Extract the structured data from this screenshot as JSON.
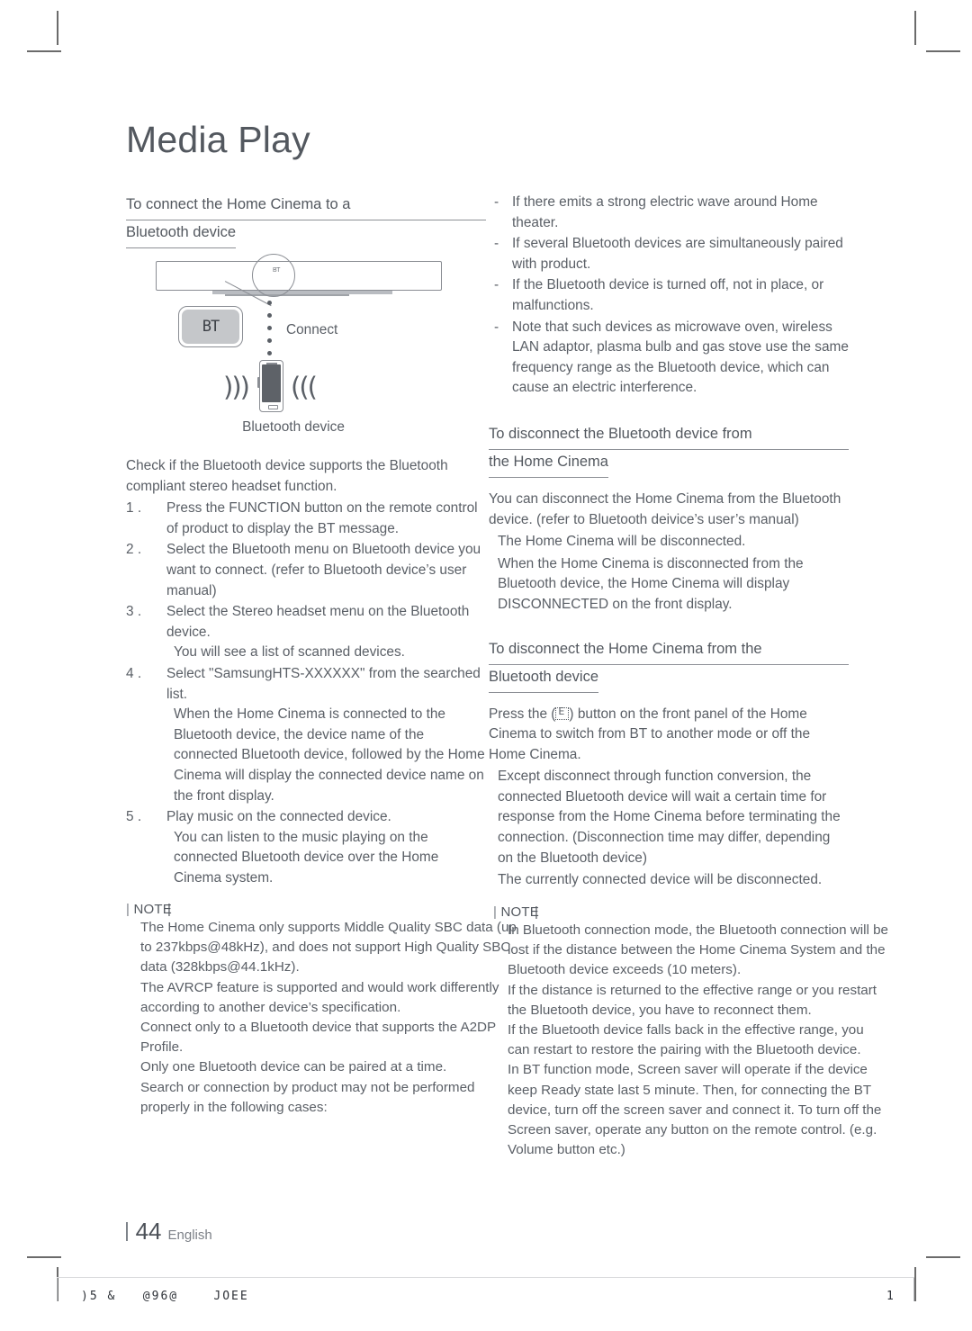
{
  "page": {
    "title": "Media Play",
    "footer_page_number": "44",
    "footer_language": "English",
    "footer_code": ")5 &   @96@    JOEE",
    "footer_sheet_number": "1"
  },
  "left_column": {
    "section1": {
      "heading_line1": "To connect the Home Cinema to a",
      "heading_line2": "Bluetooth device"
    },
    "diagram": {
      "bt_label": "BT",
      "zoom_mini_label": "BT",
      "connect_label": "Connect",
      "device_label": "Bluetooth device"
    },
    "intro": "Check if the Bluetooth device supports the Bluetooth compliant stereo headset function.",
    "steps": [
      {
        "num": "1 .",
        "text": "Press the FUNCTION button on the remote control of product to display the BT message.",
        "sub": []
      },
      {
        "num": "2 .",
        "text": "Select the Bluetooth menu on Bluetooth device you want to connect. (refer to Bluetooth device’s user manual)",
        "sub": []
      },
      {
        "num": "3 .",
        "text": "Select the Stereo headset menu on the Bluetooth device.",
        "sub": [
          "You will see a list of scanned devices."
        ]
      },
      {
        "num": "4 .",
        "text": "Select \"SamsungHTS-XXXXXX\" from the searched list.",
        "sub": [
          "When the Home Cinema is connected to the Bluetooth device, the device name of the connected Bluetooth device, followed by the Home Cinema will display the connected device name on the front display."
        ]
      },
      {
        "num": "5 .",
        "text": "Play music on the connected device.",
        "sub": [
          "You can listen to the music playing on the connected Bluetooth device over the Home Cinema system."
        ]
      }
    ]
  },
  "right_column": {
    "interference_list": [
      "If there emits a strong electric wave around Home theater.",
      "If several Bluetooth devices are simultaneously paired with product.",
      "If the Bluetooth device is turned off, not in place, or malfunctions.",
      "Note that such devices as microwave oven, wireless LAN adaptor, plasma bulb and gas stove use the same frequency range as the Bluetooth device, which can cause an electric interference."
    ],
    "section2": {
      "heading_line1": "To disconnect the Bluetooth device from",
      "heading_line2": "the Home Cinema",
      "body": "You can disconnect the Home Cinema from the Bluetooth device. (refer to Bluetooth deivice’s user’s manual)",
      "bullets": [
        "The Home Cinema will be disconnected.",
        "When the Home Cinema is disconnected from the Bluetooth device, the Home Cinema will display DISCONNECTED on the front display."
      ]
    },
    "section3": {
      "heading_line1": "To disconnect the Home Cinema from the",
      "heading_line2": "Bluetooth device",
      "body_before_icon": "Press the (",
      "body_icon": "front-panel-button-icon",
      "body_after_icon": ") button on the front panel of the Home Cinema to switch from BT to another mode or off the Home Cinema.",
      "bullets": [
        "Except disconnect through function conversion, the connected Bluetooth device will wait a certain time for response from the Home Cinema before terminating the connection. (Disconnection time may differ, depending on the Bluetooth device)",
        "The currently connected device will be disconnected."
      ]
    }
  },
  "note_left": {
    "label": "NOTE",
    "items": [
      "The Home Cinema only supports Middle Quality SBC data (up to 237kbps@48kHz), and does not support High Quality SBC data (328kbps@44.1kHz).",
      "The AVRCP feature is supported and would work differently according to another device’s specification.",
      "Connect only to a Bluetooth device that supports the A2DP Profile.",
      "Only one Bluetooth device can be paired at a time.",
      "Search or connection by product may not be performed properly in the following cases:"
    ]
  },
  "note_right": {
    "label": "NOTE",
    "items": [
      "In Bluetooth connection mode, the Bluetooth connection will be lost if the distance between the Home Cinema System and the Bluetooth device exceeds (10 meters).",
      "If the distance is returned to the effective range or you restart the Bluetooth device, you have to reconnect them.",
      "If the Bluetooth device falls back in the effective range, you can restart to restore the pairing with the Bluetooth device.",
      "In BT function mode, Screen saver will operate if the device keep Ready state last 5 minute. Then, for connecting the BT device, turn off the screen saver and connect it. To turn off the Screen saver, operate any button on the remote control. (e.g. Volume button etc.)"
    ]
  }
}
